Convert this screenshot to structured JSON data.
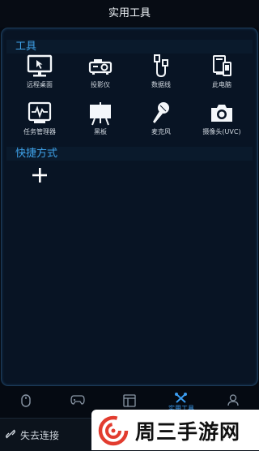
{
  "header": {
    "title": "实用工具"
  },
  "tools_section": {
    "title": "工具",
    "items": [
      {
        "label": "远程桌面",
        "icon": "monitor-icon"
      },
      {
        "label": "投影仪",
        "icon": "projector-icon"
      },
      {
        "label": "数据线",
        "icon": "usb-cable-icon"
      },
      {
        "label": "此电脑",
        "icon": "computer-icon"
      },
      {
        "label": "任务管理器",
        "icon": "task-monitor-icon"
      },
      {
        "label": "黑板",
        "icon": "blackboard-icon"
      },
      {
        "label": "麦克风",
        "icon": "microphone-icon"
      },
      {
        "label": "摄像头(UVC)",
        "icon": "camera-icon"
      }
    ]
  },
  "shortcuts_section": {
    "title": "快捷方式",
    "add_icon": "plus-icon"
  },
  "tabbar": {
    "tabs": [
      {
        "icon": "mouse-icon",
        "label": ""
      },
      {
        "icon": "gamepad-icon",
        "label": ""
      },
      {
        "icon": "layout-icon",
        "label": ""
      },
      {
        "icon": "tools-icon",
        "label": "实用工具",
        "active": true
      },
      {
        "icon": "user-icon",
        "label": ""
      }
    ]
  },
  "status": {
    "text": "失去连接",
    "icon": "link-broken-icon"
  },
  "watermark": {
    "text": "周三手游网"
  },
  "colors": {
    "accent": "#3fa3ea",
    "background": "#050a12",
    "panel": "#081424"
  }
}
